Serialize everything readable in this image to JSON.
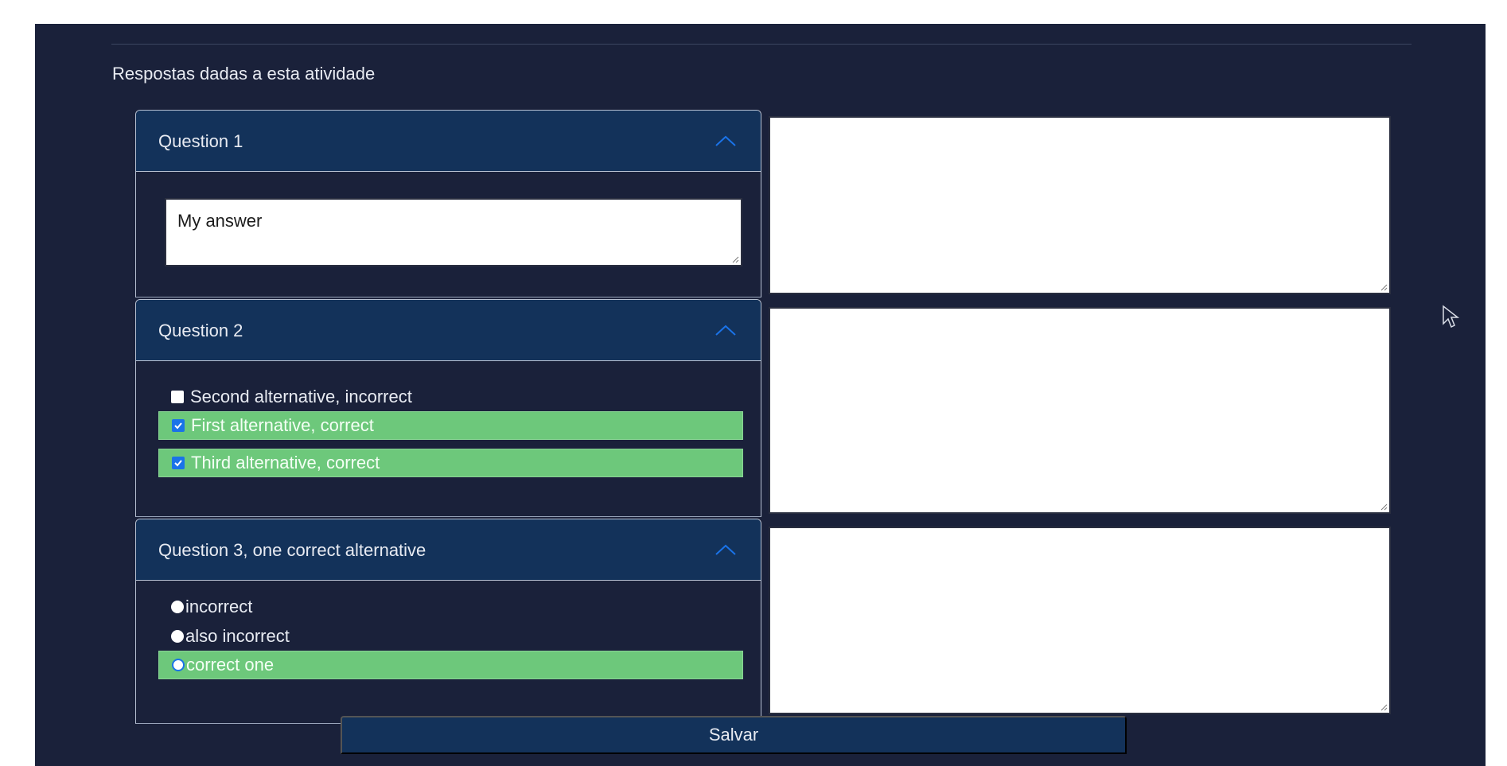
{
  "section_title": "Respostas dadas a esta atividade",
  "questions": [
    {
      "title": "Question 1",
      "type": "text",
      "answer": "My answer"
    },
    {
      "title": "Question 2",
      "type": "checkbox",
      "options": [
        {
          "label": "Second alternative, incorrect",
          "checked": false,
          "correct": false
        },
        {
          "label": "First alternative, correct",
          "checked": true,
          "correct": true
        },
        {
          "label": "Third alternative, correct",
          "checked": true,
          "correct": true
        }
      ]
    },
    {
      "title": "Question 3, one correct alternative",
      "type": "radio",
      "options": [
        {
          "label": "incorrect",
          "selected": false,
          "correct": false
        },
        {
          "label": "also incorrect",
          "selected": false,
          "correct": false
        },
        {
          "label": "correct one",
          "selected": true,
          "correct": true
        }
      ]
    }
  ],
  "comments": [
    "",
    "",
    ""
  ],
  "save_label": "Salvar",
  "colors": {
    "background": "#1a213a",
    "header": "#13325a",
    "correct": "#6dc87b",
    "accent": "#1a73e8"
  },
  "icons": {
    "collapse": "chevron-up-icon",
    "resize": "resize-grip-icon",
    "pointer": "cursor-icon"
  }
}
